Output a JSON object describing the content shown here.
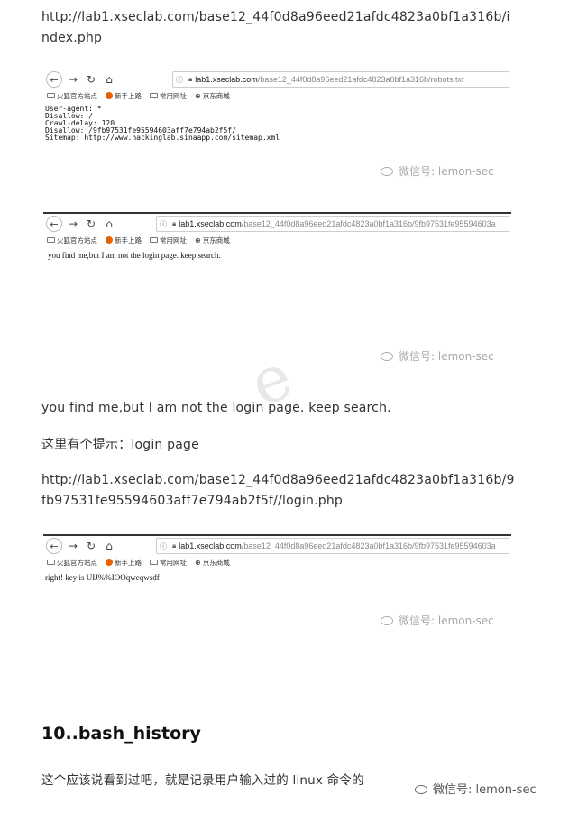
{
  "para_url1_line1": "http://lab1.xseclab.com/base12_44f0d8a96eed21afdc4823a0bf1a316b/i",
  "para_url1_line2": "ndex.php",
  "shot1": {
    "url_host": "lab1.xseclab.com",
    "url_path": "/base12_44f0d8a96eed21afdc4823a0bf1a316b/robots.txt",
    "robots_lines": [
      "User-agent: *",
      "Disallow: /",
      "Crawl-delay: 120",
      "Disallow: /9fb97531fe95594603aff7e794ab2f5f/",
      "Sitemap: http://www.hackinglab.sinaapp.com/sitemap.xml"
    ]
  },
  "shot2": {
    "url_host": "lab1.xseclab.com",
    "url_path": "/base12_44f0d8a96eed21afdc4823a0bf1a316b/9fb97531fe95594603a",
    "content": "you find me,but I am not the login page. keep search."
  },
  "shot3": {
    "url_host": "lab1.xseclab.com",
    "url_path": "/base12_44f0d8a96eed21afdc4823a0bf1a316b/9fb97531fe95594603a",
    "content": "right! key is UIJ%%IOOqweqwsdf"
  },
  "bookmarks": {
    "item1": "火狐官方站点",
    "item2": "新手上路",
    "item3": "常用网址",
    "item4": "京东商城"
  },
  "watermark": "微信号: lemon-sec",
  "para_found": "you find me,but I am not the login page. keep search.",
  "para_hint": "这里有个提示：login page",
  "para_url2_line1": "http://lab1.xseclab.com/base12_44f0d8a96eed21afdc4823a0bf1a316b/9",
  "para_url2_line2": "fb97531fe95594603aff7e794ab2f5f//login.php",
  "heading": "10..bash_history",
  "para_last": "这个应该说看到过吧，就是记录用户输入过的 linux 命令的"
}
